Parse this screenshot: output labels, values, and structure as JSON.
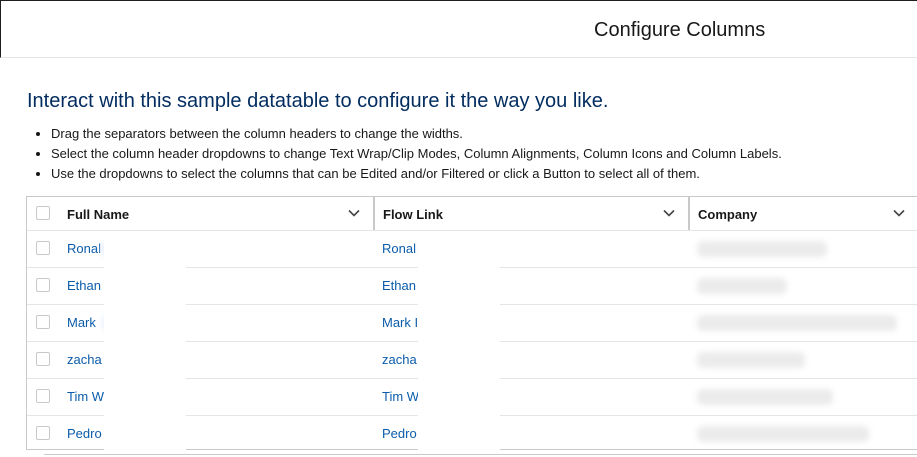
{
  "modal": {
    "title": "Configure Columns"
  },
  "intro": "Interact with this sample datatable to configure it the way you like.",
  "instructions": [
    "Drag the separators between the column headers to change the widths.",
    "Select the column header dropdowns to change Text Wrap/Clip Modes, Column Alignments, Column Icons and Column Labels.",
    "Use the dropdowns to select the columns that can be Edited and/or Filtered or click a Button to select all of them."
  ],
  "table": {
    "columns": [
      {
        "label": "Full Name"
      },
      {
        "label": "Flow Link"
      },
      {
        "label": "Company"
      }
    ],
    "rows": [
      {
        "full_name": "Ronal",
        "flow_link": "Ronal"
      },
      {
        "full_name": "Ethan",
        "flow_link": "Ethan"
      },
      {
        "full_name": "Mark",
        "flow_link": "Mark I"
      },
      {
        "full_name": "zacha",
        "flow_link": "zacha"
      },
      {
        "full_name": "Tim W",
        "flow_link": "Tim W"
      },
      {
        "full_name": "Pedro",
        "flow_link": "Pedro"
      }
    ]
  },
  "colors": {
    "link": "#0b5cab",
    "heading": "#032d60",
    "border": "#c9c9c9"
  },
  "icons": {
    "header_dropdown": "chevron-down-icon"
  }
}
